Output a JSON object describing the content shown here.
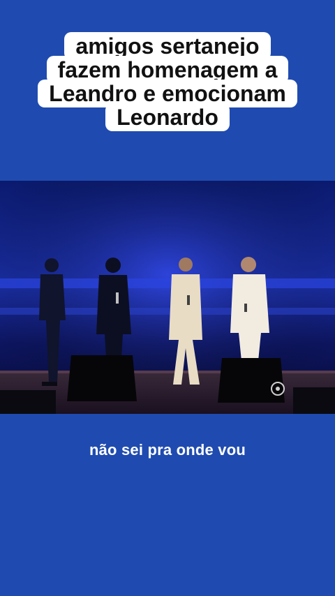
{
  "title": {
    "lines": [
      "amigos sertanejo",
      "fazem homenagem a",
      "Leandro e emocionam",
      "Leonardo"
    ]
  },
  "video": {
    "description_icon": "broadcast-logo-icon"
  },
  "caption": {
    "text": "não sei pra onde vou"
  },
  "colors": {
    "background": "#1f4bb0",
    "title_box": "#ffffff",
    "title_text": "#111111",
    "caption_text": "#ffffff"
  }
}
